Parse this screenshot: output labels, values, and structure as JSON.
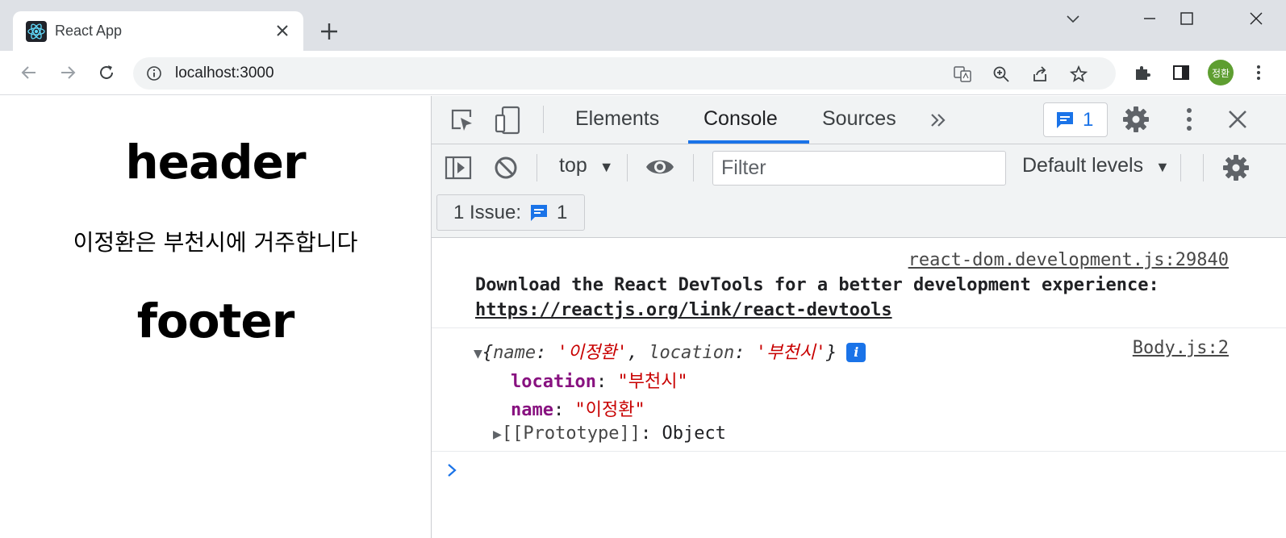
{
  "browser": {
    "tab_title": "React App",
    "url": "localhost:3000",
    "profile_initials": "정환"
  },
  "page": {
    "header": "header",
    "body_text": "이정환은 부천시에 거주합니다",
    "footer": "footer"
  },
  "devtools": {
    "tabs": [
      {
        "label": "Elements",
        "active": false
      },
      {
        "label": "Console",
        "active": true
      },
      {
        "label": "Sources",
        "active": false
      }
    ],
    "issues_count": "1",
    "context": "top",
    "filter_placeholder": "Filter",
    "levels_label": "Default levels",
    "issues_bar": {
      "label": "1 Issue:",
      "count": "1"
    },
    "console": {
      "message1": {
        "source": "react-dom.development.js:29840",
        "text": "Download the React DevTools for a better development experience:",
        "link": "https://reactjs.org/link/react-devtools"
      },
      "message2": {
        "source": "Body.js:2",
        "summary": {
          "open": "{",
          "k1": "name",
          "v1": "'이정환'",
          "k2": "location",
          "v2": "'부천시'",
          "close": "}"
        },
        "properties": [
          {
            "key": "location",
            "value": "\"부천시\""
          },
          {
            "key": "name",
            "value": "\"이정환\""
          }
        ],
        "prototype": {
          "key": "[[Prototype]]",
          "value": "Object"
        }
      }
    }
  },
  "colors": {
    "accent": "#1a73e8",
    "string": "#c80000",
    "property": "#881280",
    "avatar": "#5e9e31"
  }
}
